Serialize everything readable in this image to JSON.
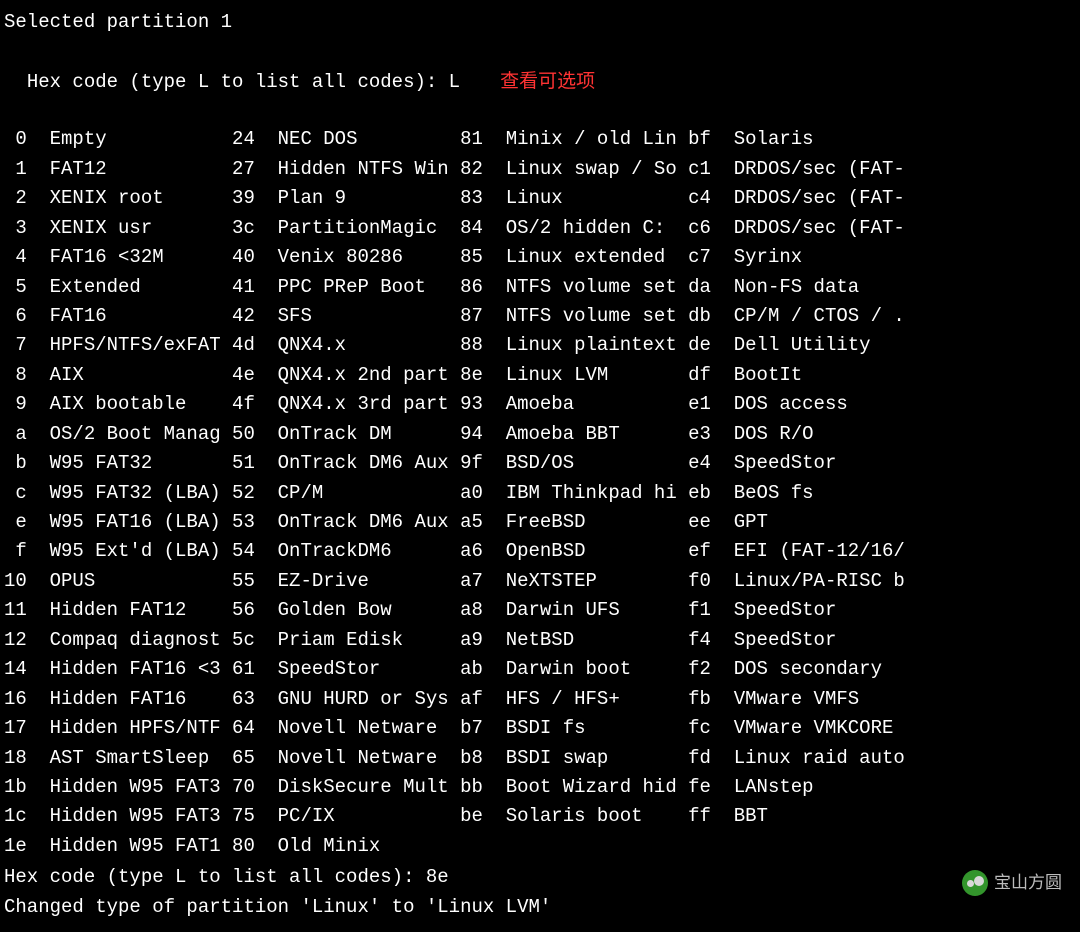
{
  "header": {
    "line1": "Selected partition 1",
    "prompt1": "Hex code (type L to list all codes): L",
    "annotation": "查看可选项"
  },
  "footer": {
    "prompt2": "Hex code (type L to list all codes): 8e",
    "result": "Changed type of partition 'Linux' to 'Linux LVM'"
  },
  "watermark": "宝山方圆",
  "rows": [
    {
      "c1": " 0",
      "n1": "Empty",
      "c2": "24",
      "n2": "NEC DOS",
      "c3": "81",
      "n3": "Minix / old Lin",
      "c4": "bf",
      "n4": "Solaris"
    },
    {
      "c1": " 1",
      "n1": "FAT12",
      "c2": "27",
      "n2": "Hidden NTFS Win",
      "c3": "82",
      "n3": "Linux swap / So",
      "c4": "c1",
      "n4": "DRDOS/sec (FAT-"
    },
    {
      "c1": " 2",
      "n1": "XENIX root",
      "c2": "39",
      "n2": "Plan 9",
      "c3": "83",
      "n3": "Linux",
      "c4": "c4",
      "n4": "DRDOS/sec (FAT-"
    },
    {
      "c1": " 3",
      "n1": "XENIX usr",
      "c2": "3c",
      "n2": "PartitionMagic",
      "c3": "84",
      "n3": "OS/2 hidden C:",
      "c4": "c6",
      "n4": "DRDOS/sec (FAT-"
    },
    {
      "c1": " 4",
      "n1": "FAT16 <32M",
      "c2": "40",
      "n2": "Venix 80286",
      "c3": "85",
      "n3": "Linux extended",
      "c4": "c7",
      "n4": "Syrinx"
    },
    {
      "c1": " 5",
      "n1": "Extended",
      "c2": "41",
      "n2": "PPC PReP Boot",
      "c3": "86",
      "n3": "NTFS volume set",
      "c4": "da",
      "n4": "Non-FS data"
    },
    {
      "c1": " 6",
      "n1": "FAT16",
      "c2": "42",
      "n2": "SFS",
      "c3": "87",
      "n3": "NTFS volume set",
      "c4": "db",
      "n4": "CP/M / CTOS / ."
    },
    {
      "c1": " 7",
      "n1": "HPFS/NTFS/exFAT",
      "c2": "4d",
      "n2": "QNX4.x",
      "c3": "88",
      "n3": "Linux plaintext",
      "c4": "de",
      "n4": "Dell Utility"
    },
    {
      "c1": " 8",
      "n1": "AIX",
      "c2": "4e",
      "n2": "QNX4.x 2nd part",
      "c3": "8e",
      "n3": "Linux LVM",
      "c4": "df",
      "n4": "BootIt"
    },
    {
      "c1": " 9",
      "n1": "AIX bootable",
      "c2": "4f",
      "n2": "QNX4.x 3rd part",
      "c3": "93",
      "n3": "Amoeba",
      "c4": "e1",
      "n4": "DOS access"
    },
    {
      "c1": " a",
      "n1": "OS/2 Boot Manag",
      "c2": "50",
      "n2": "OnTrack DM",
      "c3": "94",
      "n3": "Amoeba BBT",
      "c4": "e3",
      "n4": "DOS R/O"
    },
    {
      "c1": " b",
      "n1": "W95 FAT32",
      "c2": "51",
      "n2": "OnTrack DM6 Aux",
      "c3": "9f",
      "n3": "BSD/OS",
      "c4": "e4",
      "n4": "SpeedStor"
    },
    {
      "c1": " c",
      "n1": "W95 FAT32 (LBA)",
      "c2": "52",
      "n2": "CP/M",
      "c3": "a0",
      "n3": "IBM Thinkpad hi",
      "c4": "eb",
      "n4": "BeOS fs"
    },
    {
      "c1": " e",
      "n1": "W95 FAT16 (LBA)",
      "c2": "53",
      "n2": "OnTrack DM6 Aux",
      "c3": "a5",
      "n3": "FreeBSD",
      "c4": "ee",
      "n4": "GPT"
    },
    {
      "c1": " f",
      "n1": "W95 Ext'd (LBA)",
      "c2": "54",
      "n2": "OnTrackDM6",
      "c3": "a6",
      "n3": "OpenBSD",
      "c4": "ef",
      "n4": "EFI (FAT-12/16/"
    },
    {
      "c1": "10",
      "n1": "OPUS",
      "c2": "55",
      "n2": "EZ-Drive",
      "c3": "a7",
      "n3": "NeXTSTEP",
      "c4": "f0",
      "n4": "Linux/PA-RISC b"
    },
    {
      "c1": "11",
      "n1": "Hidden FAT12",
      "c2": "56",
      "n2": "Golden Bow",
      "c3": "a8",
      "n3": "Darwin UFS",
      "c4": "f1",
      "n4": "SpeedStor"
    },
    {
      "c1": "12",
      "n1": "Compaq diagnost",
      "c2": "5c",
      "n2": "Priam Edisk",
      "c3": "a9",
      "n3": "NetBSD",
      "c4": "f4",
      "n4": "SpeedStor"
    },
    {
      "c1": "14",
      "n1": "Hidden FAT16 <3",
      "c2": "61",
      "n2": "SpeedStor",
      "c3": "ab",
      "n3": "Darwin boot",
      "c4": "f2",
      "n4": "DOS secondary"
    },
    {
      "c1": "16",
      "n1": "Hidden FAT16",
      "c2": "63",
      "n2": "GNU HURD or Sys",
      "c3": "af",
      "n3": "HFS / HFS+",
      "c4": "fb",
      "n4": "VMware VMFS"
    },
    {
      "c1": "17",
      "n1": "Hidden HPFS/NTF",
      "c2": "64",
      "n2": "Novell Netware",
      "c3": "b7",
      "n3": "BSDI fs",
      "c4": "fc",
      "n4": "VMware VMKCORE"
    },
    {
      "c1": "18",
      "n1": "AST SmartSleep",
      "c2": "65",
      "n2": "Novell Netware",
      "c3": "b8",
      "n3": "BSDI swap",
      "c4": "fd",
      "n4": "Linux raid auto"
    },
    {
      "c1": "1b",
      "n1": "Hidden W95 FAT3",
      "c2": "70",
      "n2": "DiskSecure Mult",
      "c3": "bb",
      "n3": "Boot Wizard hid",
      "c4": "fe",
      "n4": "LANstep"
    },
    {
      "c1": "1c",
      "n1": "Hidden W95 FAT3",
      "c2": "75",
      "n2": "PC/IX",
      "c3": "be",
      "n3": "Solaris boot",
      "c4": "ff",
      "n4": "BBT"
    },
    {
      "c1": "1e",
      "n1": "Hidden W95 FAT1",
      "c2": "80",
      "n2": "Old Minix",
      "c3": "",
      "n3": "",
      "c4": "",
      "n4": ""
    }
  ]
}
